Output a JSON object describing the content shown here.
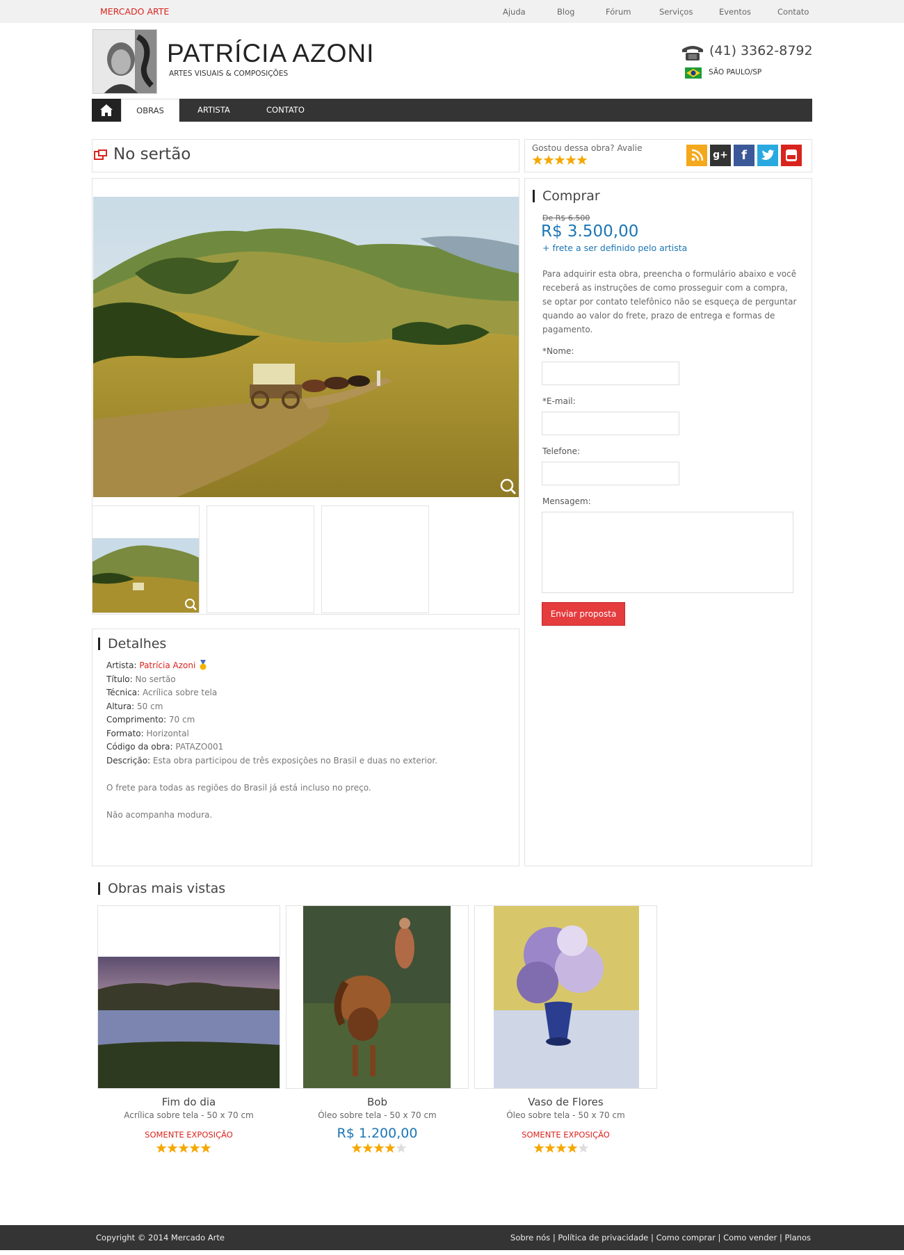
{
  "topbar": {
    "brand": "MERCADO ARTE",
    "links": [
      "Ajuda",
      "Blog",
      "Fórum",
      "Serviços",
      "Eventos",
      "Contato"
    ]
  },
  "header": {
    "name": "PATRÍCIA AZONI",
    "tagline": "ARTES VISUAIS & COMPOSIÇÕES",
    "phone": "(41) 3362-8792",
    "location": "SÃO PAULO/SP"
  },
  "nav": {
    "items": [
      "OBRAS",
      "ARTISTA",
      "CONTATO"
    ],
    "active": "OBRAS"
  },
  "artwork": {
    "title": "No sertão",
    "rate_prompt": "Gostou dessa obra? Avalie",
    "rating": 5
  },
  "social": [
    "rss",
    "google-plus",
    "facebook",
    "twitter",
    "youtube"
  ],
  "buy": {
    "heading": "Comprar",
    "old_price": "De R$ 6.500",
    "price": "R$ 3.500,00",
    "shipping": "+ frete a ser definido pelo artista",
    "intro": "Para adquirir esta obra, preencha o formulário abaixo e você receberá as instruções de como prosseguir com a compra, se optar por contato telefônico não se esqueça de perguntar quando ao valor do frete, prazo de entrega e formas de pagamento.",
    "fields": {
      "name": "*Nome:",
      "email": "*E-mail:",
      "phone": "Telefone:",
      "message": "Mensagem:"
    },
    "submit": "Enviar proposta"
  },
  "details": {
    "heading": "Detalhes",
    "artist_label": "Artista:",
    "artist": "Patrícia Azoni",
    "title_label": "Título:",
    "title": "No sertão",
    "technique_label": "Técnica:",
    "technique": "Acrílica sobre tela",
    "height_label": "Altura:",
    "height": "50 cm",
    "length_label": "Comprimento:",
    "length": "70 cm",
    "format_label": "Formato:",
    "format": "Horizontal",
    "code_label": "Código da obra:",
    "code": "PATAZO001",
    "desc_label": "Descrição:",
    "desc": "Esta obra participou de três exposições no Brasil e duas no exterior.",
    "note1": "O frete para todas as regiões do Brasil já está incluso no preço.",
    "note2": "Não acompanha modura."
  },
  "popular": {
    "heading": "Obras mais vistas",
    "items": [
      {
        "title": "Fim do dia",
        "sub": "Acrílica sobre tela - 50 x 70 cm",
        "tag": "SOMENTE EXPOSIÇÃO",
        "rating": 5
      },
      {
        "title": "Bob",
        "sub": "Óleo sobre tela - 50 x 70 cm",
        "price": "R$ 1.200,00",
        "rating": 4
      },
      {
        "title": "Vaso de Flores",
        "sub": "Óleo sobre tela - 50 x 70 cm",
        "tag": "SOMENTE EXPOSIÇÃO",
        "rating": 4
      }
    ]
  },
  "footer": {
    "copyright": "Copyright © 2014 Mercado Arte",
    "links": "Sobre nós | Política de privacidade | Como comprar | Como vender | Planos"
  },
  "colors": {
    "accent_red": "#d9241e",
    "price_blue": "#1b76b5",
    "star": "#f5a800",
    "nav_dark": "#343434"
  }
}
